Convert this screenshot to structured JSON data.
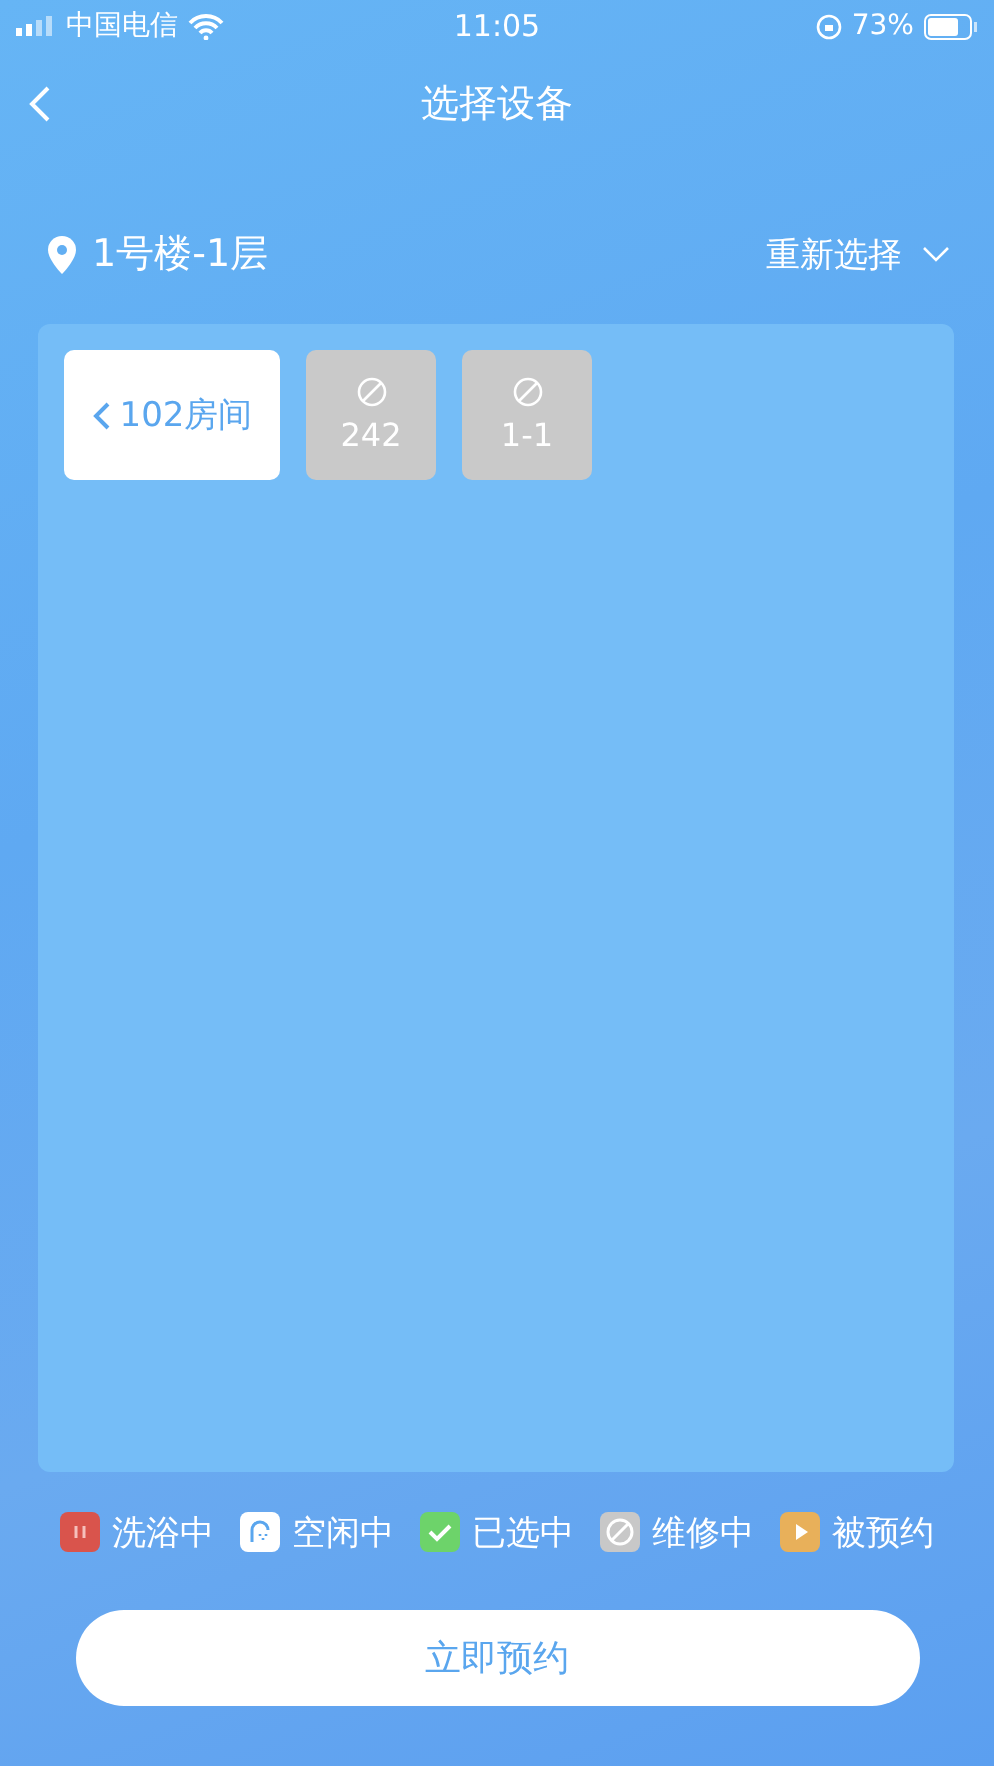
{
  "status_bar": {
    "carrier": "中国电信",
    "time": "11:05",
    "battery": "73%"
  },
  "nav": {
    "title": "选择设备"
  },
  "location": {
    "name": "1号楼-1层",
    "action": "重新选择"
  },
  "devices": [
    {
      "kind": "room",
      "label": "102房间"
    },
    {
      "kind": "repair",
      "label": "242"
    },
    {
      "kind": "repair",
      "label": "1-1"
    }
  ],
  "legend": [
    {
      "kind": "bathing",
      "label": "洗浴中",
      "color": "#d9544c"
    },
    {
      "kind": "idle",
      "label": "空闲中",
      "color": "#ffffff"
    },
    {
      "kind": "selected",
      "label": "已选中",
      "color": "#6dd36a"
    },
    {
      "kind": "repair",
      "label": "维修中",
      "color": "#c8c8c8"
    },
    {
      "kind": "reserved",
      "label": "被预约",
      "color": "#e8b05a"
    }
  ],
  "book_button": "立即预约"
}
